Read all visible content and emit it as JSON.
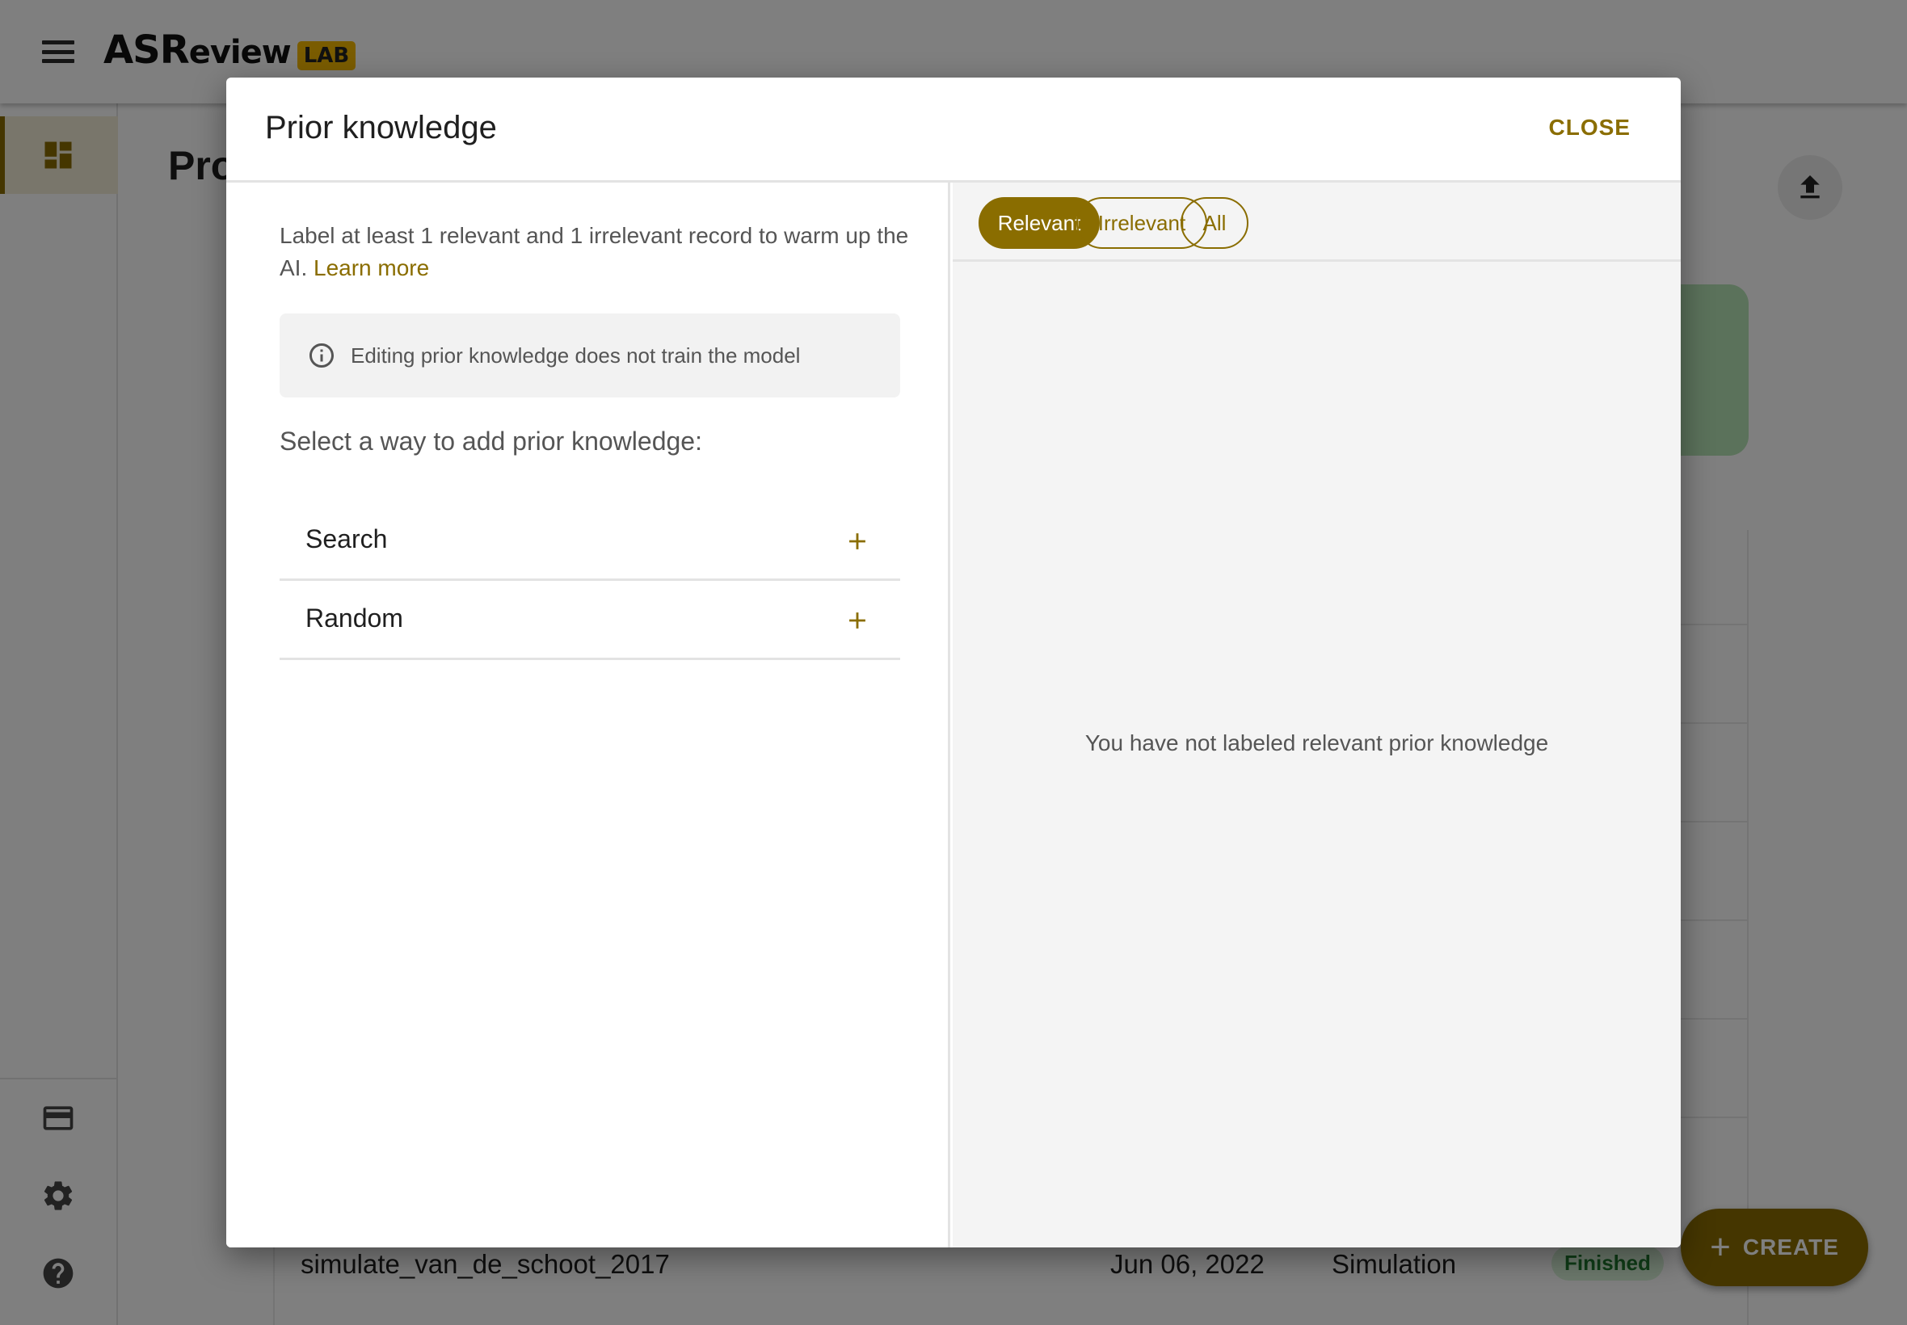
{
  "app": {
    "logo_main": "ASR",
    "logo_sub": "eview",
    "logo_badge": "LAB",
    "page_title": "Projects"
  },
  "background_row": {
    "name": "simulate_van_de_schoot_2017",
    "date": "Jun 06, 2022",
    "mode": "Simulation",
    "status": "Finished"
  },
  "create_button": {
    "label": "CREATE"
  },
  "dialog": {
    "title": "Prior knowledge",
    "close_label": "CLOSE",
    "intro_text": "Label at least 1 relevant and 1 irrelevant record to warm up the AI.",
    "learn_more": "Learn more",
    "info_text": "Editing prior knowledge does not train the model",
    "select_label": "Select a way to add prior knowledge:",
    "options": [
      {
        "label": "Search"
      },
      {
        "label": "Random"
      }
    ],
    "filters": [
      {
        "label": "Relevant",
        "active": true
      },
      {
        "label": "Irrelevant",
        "active": false
      },
      {
        "label": "All",
        "active": false
      }
    ],
    "empty_message": "You have not labeled relevant prior knowledge"
  },
  "colors": {
    "accent": "#8a6d00",
    "badge": "#f5b800",
    "overlay": "rgba(0,0,0,0.5)"
  },
  "icons": {
    "menu": "menu-icon",
    "dashboard": "dashboard-icon",
    "card": "credit-card-icon",
    "settings": "gear-icon",
    "help": "help-icon",
    "upload": "upload-icon",
    "info": "info-icon",
    "add": "plus-icon"
  }
}
